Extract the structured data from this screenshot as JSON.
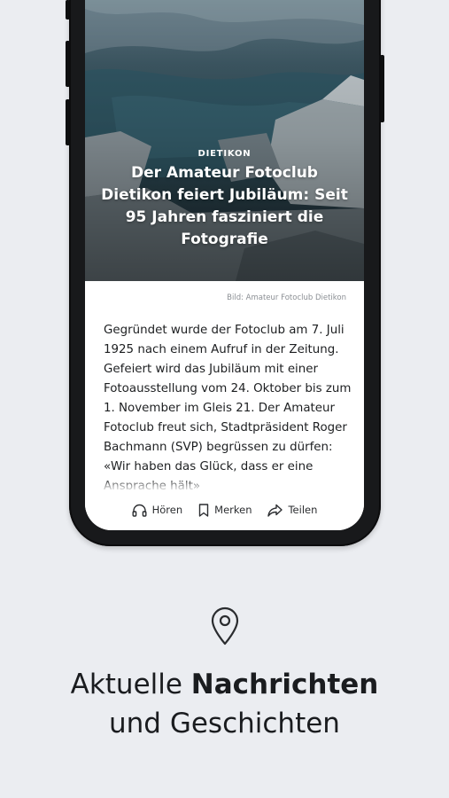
{
  "article": {
    "kicker": "DIETIKON",
    "headline": "Der Amateur Fotoclub Dietikon feiert Jubiläum: Seit 95 Jahren fasziniert die Fotografie",
    "image_credit": "Bild: Amateur Fotoclub Dietikon",
    "body": "Gegründet wurde der Fotoclub am 7. Juli 1925 nach einem Aufruf in der Zeitung. Gefeiert wird das Jubiläum mit einer Fotoausstellung vom 24. Oktober bis zum 1. November im Gleis 21. Der Amateur Fotoclub freut sich, Stadtpräsident Roger Bachmann (SVP) begrüssen zu dürfen: «Wir haben das Glück, dass er eine Ansprache hält»"
  },
  "actions": {
    "listen_label": "Hören",
    "listen_icon": "headphones-icon",
    "bookmark_label": "Merken",
    "bookmark_icon": "bookmark-icon",
    "share_label": "Teilen",
    "share_icon": "share-icon"
  },
  "promo": {
    "icon": "location-pin-icon",
    "line1_regular": "Aktuelle ",
    "line1_bold": "Nachrichten",
    "line2": "und Geschichten"
  },
  "colors": {
    "background": "#ebedf1",
    "phone_frame": "#18191b",
    "text": "#1a1c1f"
  }
}
